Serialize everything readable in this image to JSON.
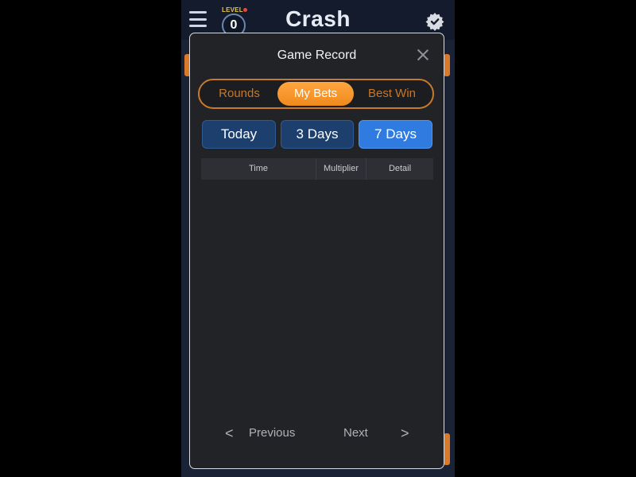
{
  "app": {
    "title": "Crash",
    "level_label": "LEVEL",
    "level_value": "0"
  },
  "modal": {
    "title": "Game Record",
    "tabs": [
      {
        "label": "Rounds"
      },
      {
        "label": "My Bets"
      },
      {
        "label": "Best Win"
      }
    ],
    "active_tab": "My Bets",
    "day_filters": [
      {
        "label": "Today"
      },
      {
        "label": "3 Days"
      },
      {
        "label": "7 Days"
      }
    ],
    "active_day_filter": "7 Days",
    "table": {
      "columns": [
        "Time",
        "Multiplier",
        "Detail"
      ],
      "rows": []
    },
    "pager": {
      "previous_label": "Previous",
      "next_label": "Next",
      "prev_icon": "<",
      "next_icon": ">"
    }
  },
  "colors": {
    "accent_orange": "#f08a1c",
    "active_blue": "#2f7be0",
    "inactive_blue": "#1c3f6e",
    "modal_bg": "#222327"
  },
  "icons": {
    "menu": "hamburger-menu-icon",
    "settings": "gear-icon",
    "close": "close-icon"
  }
}
